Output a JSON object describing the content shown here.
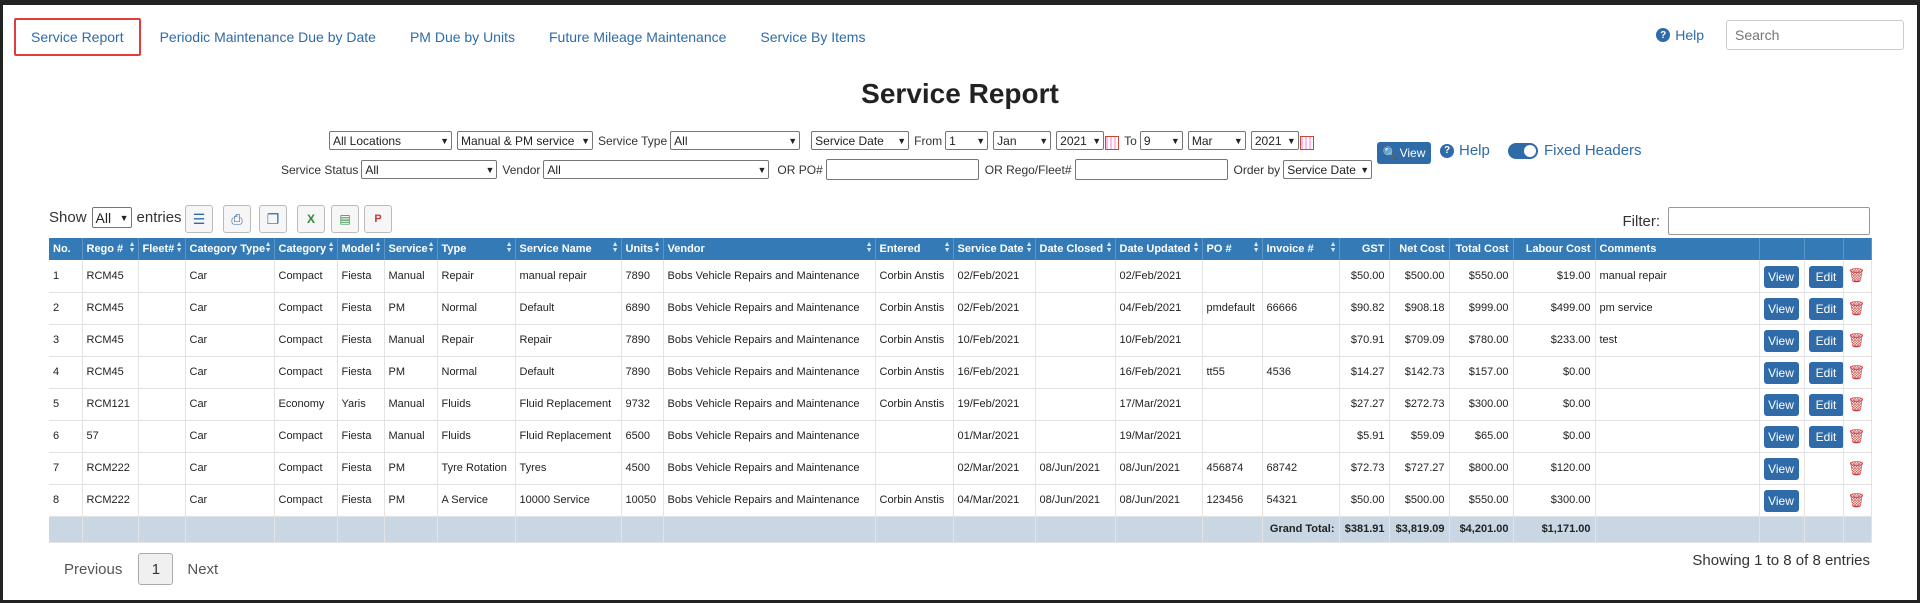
{
  "nav": {
    "tabs": [
      "Service Report",
      "Periodic Maintenance Due by Date",
      "PM Due by Units",
      "Future Mileage Maintenance",
      "Service By Items"
    ],
    "help": "Help",
    "search_placeholder": "Search"
  },
  "title": "Service Report",
  "filters": {
    "location": "All Locations",
    "service_kind": "Manual & PM service",
    "service_type_label": "Service Type",
    "service_type": "All",
    "date_field": "Service Date",
    "from_label": "From",
    "from_day": "1",
    "from_month": "Jan",
    "from_year": "2021",
    "to_label": "To",
    "to_day": "9",
    "to_month": "Mar",
    "to_year": "2021",
    "service_status_label": "Service Status",
    "service_status": "All",
    "vendor_label": "Vendor",
    "vendor": "All",
    "po_label": "OR PO#",
    "rego_label": "OR Rego/Fleet#",
    "order_label": "Order by",
    "order_by": "Service Date"
  },
  "actions": {
    "view": "View",
    "help": "Help",
    "fixed_headers": "Fixed Headers"
  },
  "listing": {
    "show": "Show",
    "page_size": "All",
    "entries": "entries",
    "filter": "Filter:"
  },
  "columns": [
    "No.",
    "Rego #",
    "Fleet#",
    "Category Type",
    "Category",
    "Model",
    "Service",
    "Type",
    "Service Name",
    "Units",
    "Vendor",
    "Entered",
    "Service Date",
    "Date Closed",
    "Date Updated",
    "PO #",
    "Invoice #",
    "GST",
    "Net Cost",
    "Total Cost",
    "Labour Cost",
    "Comments",
    "",
    "",
    ""
  ],
  "rows": [
    [
      "1",
      "RCM45",
      "",
      "Car",
      "Compact",
      "Fiesta",
      "Manual",
      "Repair",
      "manual repair",
      "7890",
      "Bobs Vehicle Repairs and Maintenance",
      "Corbin Anstis",
      "02/Feb/2021",
      "",
      "02/Feb/2021",
      "",
      "",
      "$50.00",
      "$500.00",
      "$550.00",
      "$19.00",
      "manual repair"
    ],
    [
      "2",
      "RCM45",
      "",
      "Car",
      "Compact",
      "Fiesta",
      "PM",
      "Normal",
      "Default",
      "6890",
      "Bobs Vehicle Repairs and Maintenance",
      "Corbin Anstis",
      "02/Feb/2021",
      "",
      "04/Feb/2021",
      "pmdefault",
      "66666",
      "$90.82",
      "$908.18",
      "$999.00",
      "$499.00",
      "pm service"
    ],
    [
      "3",
      "RCM45",
      "",
      "Car",
      "Compact",
      "Fiesta",
      "Manual",
      "Repair",
      "Repair",
      "7890",
      "Bobs Vehicle Repairs and Maintenance",
      "Corbin Anstis",
      "10/Feb/2021",
      "",
      "10/Feb/2021",
      "",
      "",
      "$70.91",
      "$709.09",
      "$780.00",
      "$233.00",
      "test"
    ],
    [
      "4",
      "RCM45",
      "",
      "Car",
      "Compact",
      "Fiesta",
      "PM",
      "Normal",
      "Default",
      "7890",
      "Bobs Vehicle Repairs and Maintenance",
      "Corbin Anstis",
      "16/Feb/2021",
      "",
      "16/Feb/2021",
      "tt55",
      "4536",
      "$14.27",
      "$142.73",
      "$157.00",
      "$0.00",
      ""
    ],
    [
      "5",
      "RCM121",
      "",
      "Car",
      "Economy",
      "Yaris",
      "Manual",
      "Fluids",
      "Fluid Replacement",
      "9732",
      "Bobs Vehicle Repairs and Maintenance",
      "Corbin Anstis",
      "19/Feb/2021",
      "",
      "17/Mar/2021",
      "",
      "",
      "$27.27",
      "$272.73",
      "$300.00",
      "$0.00",
      ""
    ],
    [
      "6",
      "57",
      "",
      "Car",
      "Compact",
      "Fiesta",
      "Manual",
      "Fluids",
      "Fluid Replacement",
      "6500",
      "Bobs Vehicle Repairs and Maintenance",
      "",
      "01/Mar/2021",
      "",
      "19/Mar/2021",
      "",
      "",
      "$5.91",
      "$59.09",
      "$65.00",
      "$0.00",
      ""
    ],
    [
      "7",
      "RCM222",
      "",
      "Car",
      "Compact",
      "Fiesta",
      "PM",
      "Tyre Rotation",
      "Tyres",
      "4500",
      "Bobs Vehicle Repairs and Maintenance",
      "",
      "02/Mar/2021",
      "08/Jun/2021",
      "08/Jun/2021",
      "456874",
      "68742",
      "$72.73",
      "$727.27",
      "$800.00",
      "$120.00",
      ""
    ],
    [
      "8",
      "RCM222",
      "",
      "Car",
      "Compact",
      "Fiesta",
      "PM",
      "A Service",
      "10000 Service",
      "10050",
      "Bobs Vehicle Repairs and Maintenance",
      "Corbin Anstis",
      "04/Mar/2021",
      "08/Jun/2021",
      "08/Jun/2021",
      "123456",
      "54321",
      "$50.00",
      "$500.00",
      "$550.00",
      "$300.00",
      ""
    ]
  ],
  "row_actions": {
    "view": "View",
    "edit": "Edit"
  },
  "editable_rows": [
    true,
    true,
    true,
    true,
    true,
    true,
    false,
    false
  ],
  "totals": {
    "label": "Grand Total:",
    "gst": "$381.91",
    "net": "$3,819.09",
    "total": "$4,201.00",
    "labour": "$1,171.00"
  },
  "pagination": {
    "previous": "Previous",
    "page": "1",
    "next": "Next",
    "info": "Showing 1 to 8 of 8 entries"
  }
}
